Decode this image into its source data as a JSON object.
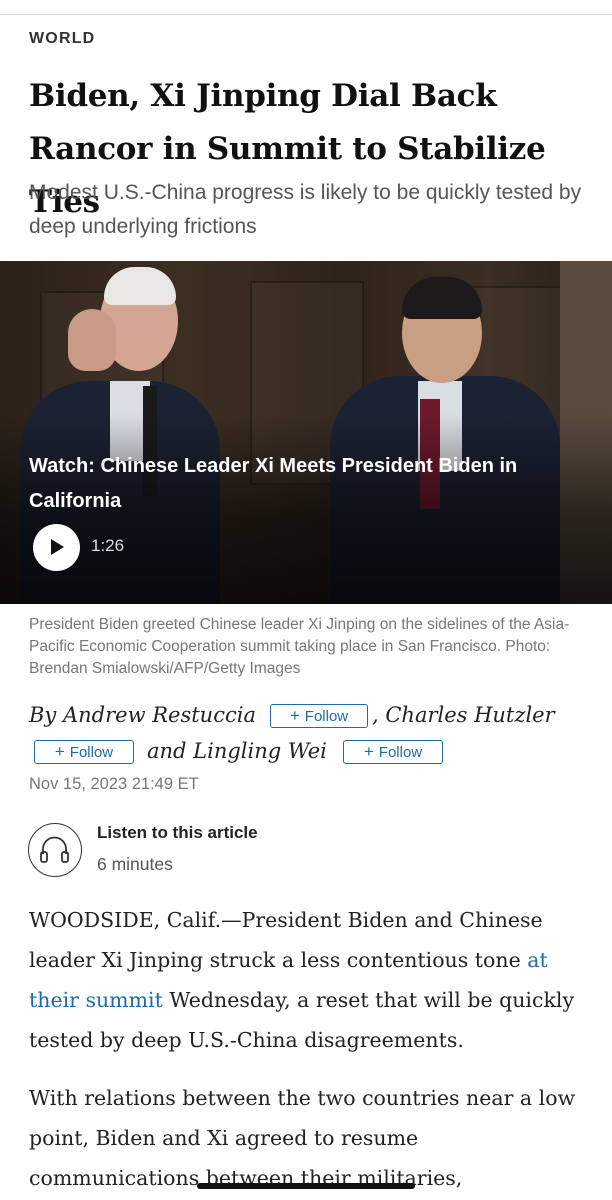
{
  "section": "WORLD",
  "headline": "Biden, Xi Jinping Dial Back Rancor in Summit to Stabilize Ties",
  "dek": "Modest U.S.-China progress is likely to be quickly tested by deep underlying frictions",
  "video": {
    "title": "Watch: Chinese Leader Xi Meets President Biden in California",
    "duration": "1:26"
  },
  "caption": "President Biden greeted Chinese leader Xi Jinping on the sidelines of the Asia-Pacific Economic Cooperation summit taking place in San Francisco. Photo: Brendan Smialowski/AFP/Getty Images",
  "byline": {
    "prefix": "By Andrew Restuccia",
    "middle": ", Charles Hutzler",
    "last": "and Lingling Wei",
    "follow_plus": "+",
    "follow_label": "Follow"
  },
  "date": "Nov 15, 2023 21:49 ET",
  "listen": {
    "title": "Listen to this article",
    "duration": "6 minutes",
    "icon": "headphones-icon"
  },
  "body": {
    "p1_before": "WOODSIDE, Calif.—President Biden and Chinese leader Xi Jinping struck a less contentious tone ",
    "p1_link": "at their summit",
    "p1_after": " Wednesday, a reset that will be quickly tested by deep U.S.-China disagreements.",
    "p2": "With relations between the two countries near a low point, Biden and Xi agreed to resume communications between their militaries,"
  },
  "colors": {
    "link": "#1f6ba8",
    "headline": "#111111",
    "meta": "#777777"
  }
}
